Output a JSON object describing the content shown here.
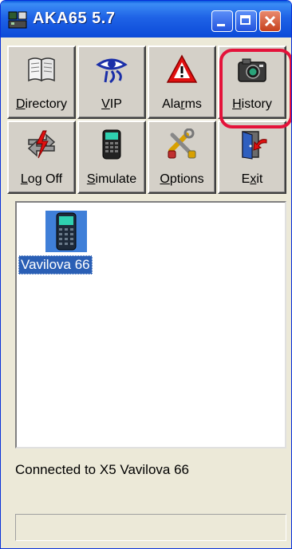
{
  "window": {
    "title": "AKA65 5.7"
  },
  "toolbar": {
    "buttons": [
      {
        "pre": "",
        "u": "D",
        "post": "irectory",
        "icon": "book-icon"
      },
      {
        "pre": "",
        "u": "V",
        "post": "IP",
        "icon": "eye-icon"
      },
      {
        "pre": "Ala",
        "u": "r",
        "post": "ms",
        "icon": "warning-icon"
      },
      {
        "pre": "",
        "u": "H",
        "post": "istory",
        "icon": "camera-icon"
      },
      {
        "pre": "",
        "u": "L",
        "post": "og Off",
        "icon": "logoff-icon"
      },
      {
        "pre": "",
        "u": "S",
        "post": "imulate",
        "icon": "handheld-icon"
      },
      {
        "pre": "",
        "u": "O",
        "post": "ptions",
        "icon": "tools-icon"
      },
      {
        "pre": "E",
        "u": "x",
        "post": "it",
        "icon": "exit-door-icon"
      }
    ]
  },
  "panel": {
    "device_label": "Vavilova 66",
    "device_icon": "handheld-device-icon"
  },
  "status": {
    "text": "Connected to X5 Vavilova 66"
  },
  "colors": {
    "titlebar": "#0b4ad8",
    "selection": "#2a5fb5",
    "highlight": "#e4123a"
  }
}
